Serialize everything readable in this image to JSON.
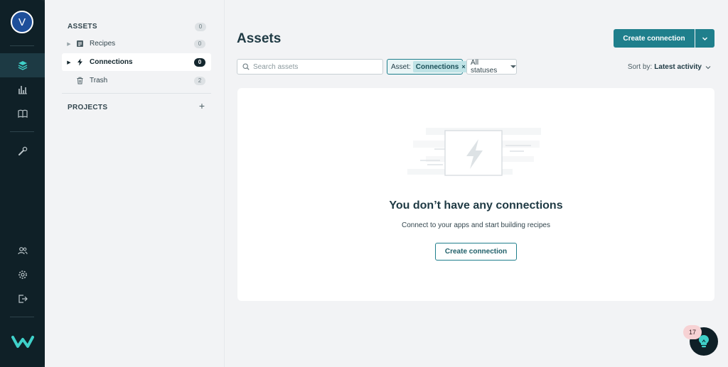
{
  "user": {
    "avatar_initial": "V"
  },
  "rail": {
    "icons": [
      "layers-icon",
      "bar-chart-icon",
      "book-icon",
      "wrench-icon",
      "users-icon",
      "settings-icon",
      "logout-icon"
    ],
    "active": "layers-icon"
  },
  "brand": {
    "logo": "workato-logo",
    "color": "#3fd0c9"
  },
  "sidebar": {
    "assets_heading": "ASSETS",
    "assets_count": "0",
    "items": [
      {
        "label": "Recipes",
        "count": "0",
        "icon": "recipe-icon"
      },
      {
        "label": "Connections",
        "count": "0",
        "icon": "lightning-icon"
      },
      {
        "label": "Trash",
        "count": "2",
        "icon": "trash-icon"
      }
    ],
    "projects_heading": "PROJECTS",
    "projects_add": "+"
  },
  "main": {
    "title": "Assets",
    "create_button": "Create connection",
    "search_placeholder": "Search assets",
    "filter_label": "Asset:",
    "filter_value": "Connections",
    "filter_remove": "×",
    "status_filter": "All statuses",
    "sort_label": "Sort by:",
    "sort_value": "Latest activity",
    "empty_title": "You don’t have any connections",
    "empty_subtitle": "Connect to your apps and start building recipes",
    "empty_button": "Create connection"
  },
  "help": {
    "notifications": "17",
    "icon": "lightbulb-icon"
  },
  "colors": {
    "accent": "#1f7f8c",
    "rail_bg": "#0f2027",
    "page_bg": "#f2f3f5"
  }
}
